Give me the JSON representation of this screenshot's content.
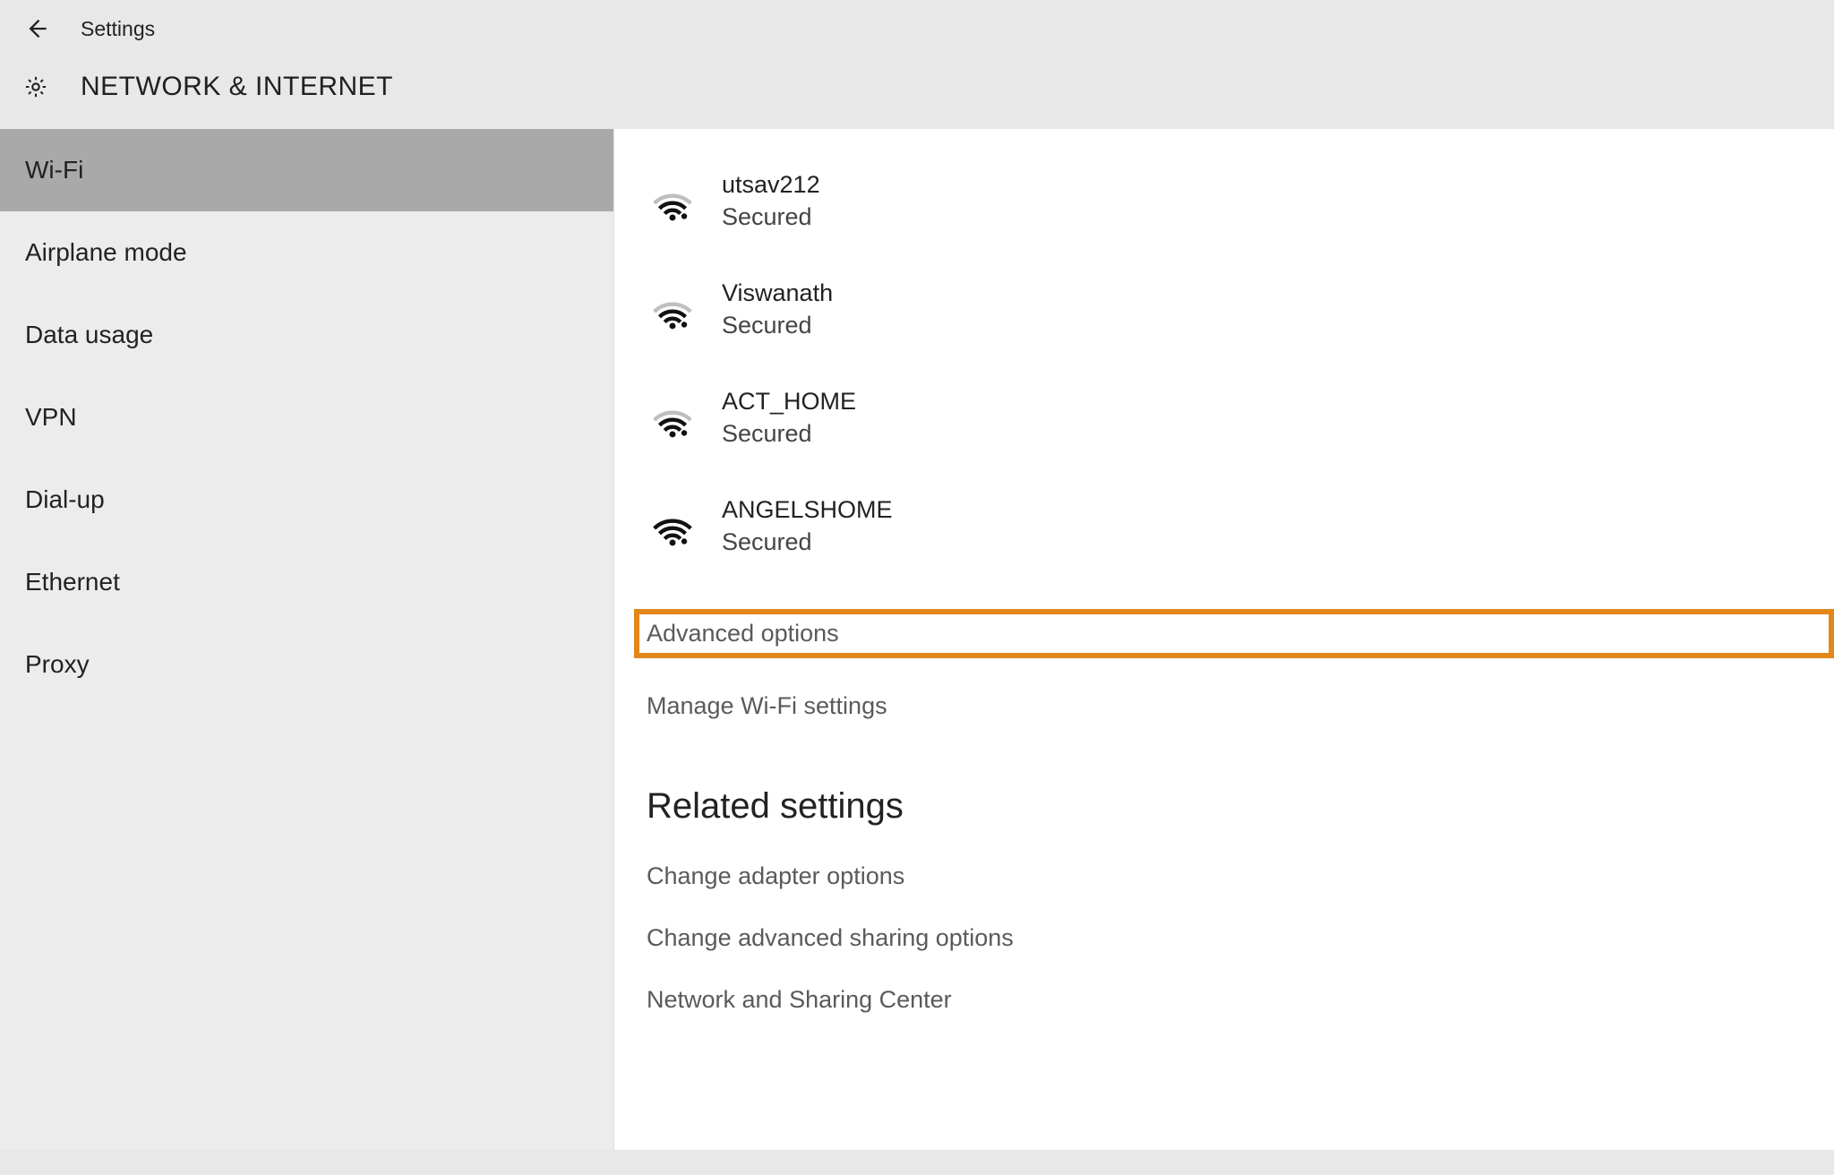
{
  "header": {
    "title": "Settings",
    "category": "NETWORK & INTERNET"
  },
  "sidebar": {
    "items": [
      {
        "label": "Wi-Fi",
        "selected": true
      },
      {
        "label": "Airplane mode",
        "selected": false
      },
      {
        "label": "Data usage",
        "selected": false
      },
      {
        "label": "VPN",
        "selected": false
      },
      {
        "label": "Dial-up",
        "selected": false
      },
      {
        "label": "Ethernet",
        "selected": false
      },
      {
        "label": "Proxy",
        "selected": false
      }
    ]
  },
  "networks": [
    {
      "name": "utsav212",
      "status": "Secured"
    },
    {
      "name": "Viswanath",
      "status": "Secured"
    },
    {
      "name": "ACT_HOME",
      "status": "Secured"
    },
    {
      "name": "ANGELSHOME",
      "status": "Secured"
    }
  ],
  "links": {
    "advanced": "Advanced options",
    "manage": "Manage Wi-Fi settings"
  },
  "related": {
    "heading": "Related settings",
    "items": [
      "Change adapter options",
      "Change advanced sharing options",
      "Network and Sharing Center"
    ]
  },
  "highlight_color": "#e2871c"
}
